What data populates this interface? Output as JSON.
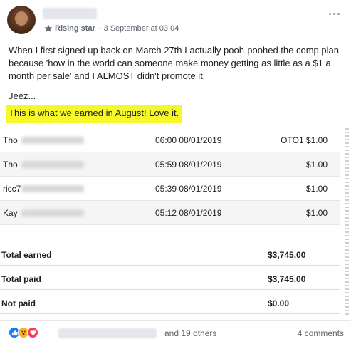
{
  "post": {
    "badge": "Rising star",
    "timestamp": "3 September at 03:04",
    "body": "When I first signed up back on March 27th I actually pooh-poohed the comp plan because 'how in the world can someone make money getting as little as a $1 a month per sale' and I ALMOST didn't promote it.",
    "jeez": "Jeez...",
    "highlight": "This is what we earned in August! Love it.",
    "highlight_color": "#f6f82c"
  },
  "table": {
    "rows": [
      {
        "name": "Tho",
        "time": "06:00 08/01/2019",
        "amount": "OTO1 $1.00"
      },
      {
        "name": "Tho",
        "time": "05:59 08/01/2019",
        "amount": "$1.00"
      },
      {
        "name": "ricc7",
        "time": "05:39 08/01/2019",
        "amount": "$1.00"
      },
      {
        "name": "Kay",
        "time": "05:12 08/01/2019",
        "amount": "$1.00"
      }
    ],
    "summary": [
      {
        "label": "Total earned",
        "value": "$3,745.00"
      },
      {
        "label": "Total paid",
        "value": "$3,745.00"
      },
      {
        "label": "Not paid",
        "value": "$0.00"
      }
    ]
  },
  "footer": {
    "others": "and 19 others",
    "comments": "4 comments",
    "reaction_icons": [
      "like-icon",
      "wow-icon",
      "love-icon"
    ]
  }
}
